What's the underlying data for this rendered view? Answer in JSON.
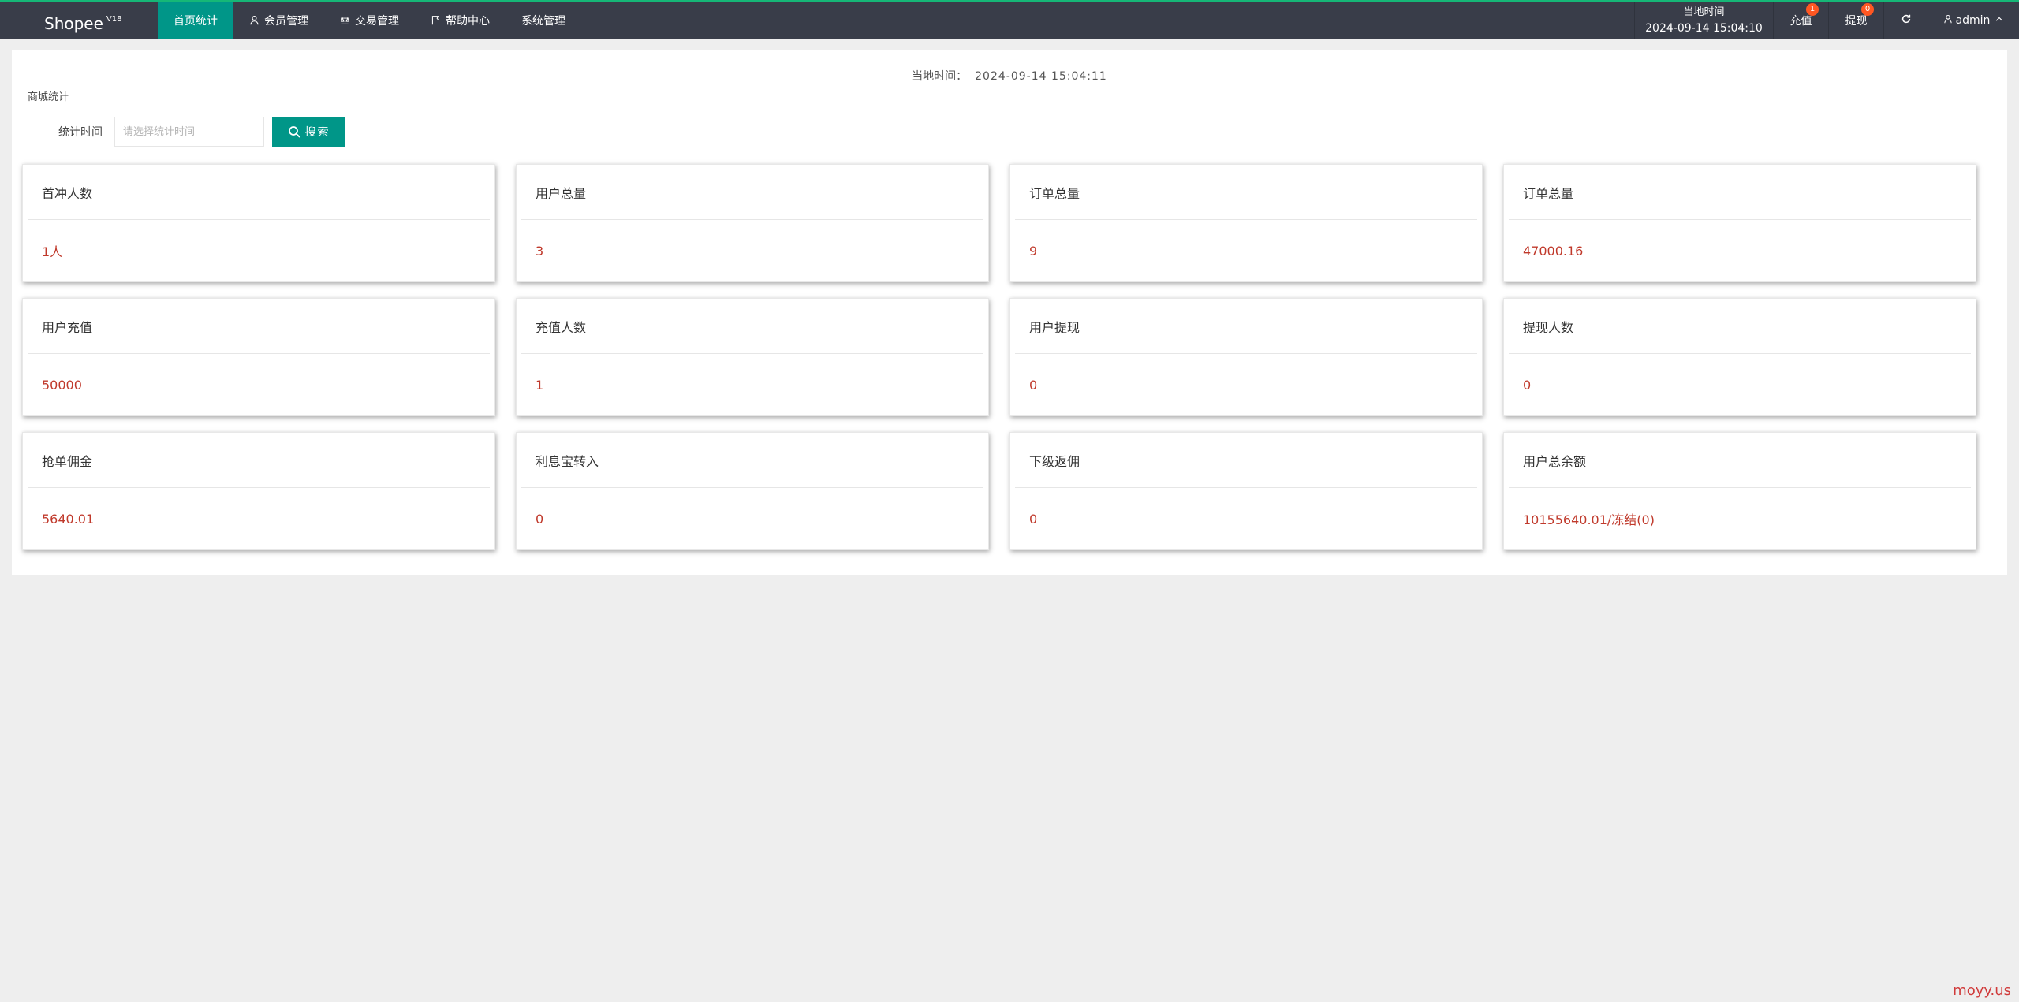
{
  "brand": {
    "name": "Shopee",
    "version": "V18"
  },
  "nav": [
    {
      "label": "首页统计",
      "icon": "",
      "active": true
    },
    {
      "label": "会员管理",
      "icon": "user-icon"
    },
    {
      "label": "交易管理",
      "icon": "scale-icon"
    },
    {
      "label": "帮助中心",
      "icon": "flag-icon"
    },
    {
      "label": "系统管理",
      "icon": ""
    }
  ],
  "header_right": {
    "time_label": "当地时间",
    "time_value": "2024-09-14 15:04:10",
    "recharge_label": "充值",
    "recharge_badge": "1",
    "withdraw_label": "提现",
    "withdraw_badge": "0",
    "user": "admin"
  },
  "panel": {
    "local_time_label": "当地时间：",
    "local_time_value": "2024-09-14 15:04:11",
    "section_title": "商城统计",
    "search_label": "统计时间",
    "search_placeholder": "请选择统计时间",
    "search_button": "搜索"
  },
  "cards": [
    {
      "title": "首冲人数",
      "value": "1人"
    },
    {
      "title": "用户总量",
      "value": "3"
    },
    {
      "title": "订单总量",
      "value": "9"
    },
    {
      "title": "订单总量",
      "value": "47000.16"
    },
    {
      "title": "用户充值",
      "value": "50000"
    },
    {
      "title": "充值人数",
      "value": "1"
    },
    {
      "title": "用户提现",
      "value": "0"
    },
    {
      "title": "提现人数",
      "value": "0"
    },
    {
      "title": "抢单佣金",
      "value": "5640.01"
    },
    {
      "title": "利息宝转入",
      "value": "0"
    },
    {
      "title": "下级返佣",
      "value": "0"
    },
    {
      "title": "用户总余额",
      "value": "10155640.01/冻结(0)"
    }
  ],
  "watermark": "moyy.us",
  "colors": {
    "topbar": "#393d49",
    "accent": "#009688",
    "value_text": "#c0392b",
    "badge": "#ff5722"
  }
}
